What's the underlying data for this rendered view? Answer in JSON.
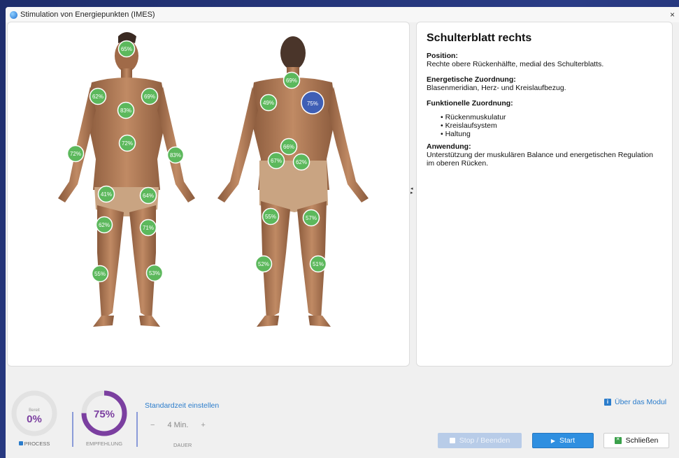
{
  "window": {
    "title": "Stimulation von Energiepunkten (IMES)",
    "close": "×"
  },
  "detail": {
    "title": "Schulterblatt rechts",
    "position_heading": "Position:",
    "position_text": "Rechte obere Rückenhälfte, medial des Schulterblatts.",
    "energy_heading": "Energetische Zuordnung:",
    "energy_text": "Blasenmeridian, Herz- und Kreislaufbezug.",
    "function_heading": "Funktionelle Zuordnung:",
    "function_items": [
      "Rückenmuskulatur",
      "Kreislaufsystem",
      "Haltung"
    ],
    "usage_heading": "Anwendung:",
    "usage_text": "Unterstützung der muskulären Balance und energetischen Regulation im oberen Rücken."
  },
  "front_points": [
    "65%",
    "62%",
    "69%",
    "83%",
    "72%",
    "72%",
    "83%",
    "41%",
    "64%",
    "62%",
    "71%",
    "55%",
    "53%"
  ],
  "back_points": [
    "69%",
    "49%",
    "75%",
    "66%",
    "67%",
    "62%",
    "55%",
    "57%",
    "52%",
    "51%"
  ],
  "selected_point": "75%",
  "colors": {
    "point": "#5cb85c",
    "selected": "#3f5fb5",
    "accent": "#7b3fa0",
    "link": "#2a7ccb"
  },
  "bottom": {
    "process": {
      "small": "Bereit",
      "value": "0%",
      "label": "PROCESS",
      "progress": 0
    },
    "recommend": {
      "value": "75%",
      "label": "EMPFEHLUNG",
      "progress": 0.75
    },
    "std_link": "Standardzeit einstellen",
    "stepper": {
      "minus": "−",
      "value": "4 Min.",
      "plus": "+"
    },
    "dauer_label": "DAUER",
    "about": "Über das Modul",
    "about_icon": "i",
    "stop": "Stop / Beenden",
    "start": "Start",
    "close": "Schließen"
  }
}
